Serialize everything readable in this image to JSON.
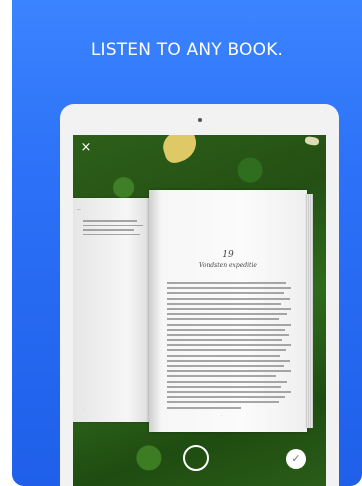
{
  "header": {
    "headline": "LISTEN TO ANY BOOK."
  },
  "camera": {
    "close_icon": "×",
    "confirm_icon": "✓"
  },
  "book": {
    "chapter_number": "19",
    "chapter_title": "Vondsten expeditie"
  },
  "colors": {
    "background_top": "#3b84ff",
    "background_bottom": "#1f5fe9",
    "headline": "#ffffff"
  }
}
